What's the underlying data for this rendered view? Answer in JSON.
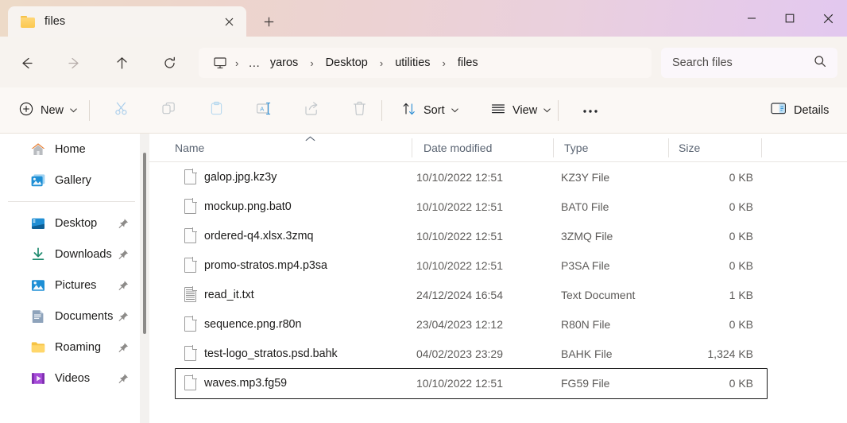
{
  "window": {
    "tab": {
      "title": "files",
      "folder_icon": "folder-icon",
      "close_icon": "close-icon"
    },
    "new_tab_icon": "plus-icon",
    "controls": {
      "minimize": "minimize-icon",
      "maximize": "maximize-icon",
      "close": "close-icon"
    }
  },
  "nav": {
    "back": "arrow-left-icon",
    "forward": "arrow-right-icon",
    "up": "arrow-up-icon",
    "refresh": "refresh-icon"
  },
  "address": {
    "pc_icon": "this-pc-monitor-icon",
    "overflow": "…",
    "crumbs": [
      "yaros",
      "Desktop",
      "utilities",
      "files"
    ],
    "separator": "›"
  },
  "search": {
    "placeholder": "Search files",
    "icon": "search-icon"
  },
  "toolbar": {
    "new_label": "New",
    "new_icon": "plus-circle-icon",
    "cut_icon": "scissors-icon",
    "copy_icon": "copy-icon",
    "paste_icon": "clipboard-paste-icon",
    "rename_icon": "rename-icon",
    "share_icon": "share-icon",
    "delete_icon": "trash-icon",
    "sort_label": "Sort",
    "sort_icon": "sort-arrows-icon",
    "view_label": "View",
    "view_icon": "list-lines-icon",
    "more_label": "•••",
    "details_label": "Details",
    "details_icon": "details-pane-icon",
    "chevron": "˅"
  },
  "sidebar": {
    "items": [
      {
        "label": "Home",
        "icon": "home-icon",
        "pinned": false
      },
      {
        "label": "Gallery",
        "icon": "gallery-photo-icon",
        "pinned": false
      },
      {
        "label": "Desktop",
        "icon": "desktop-icon",
        "pinned": true
      },
      {
        "label": "Downloads",
        "icon": "downloads-arrow-icon",
        "pinned": true
      },
      {
        "label": "Pictures",
        "icon": "pictures-icon",
        "pinned": true
      },
      {
        "label": "Documents",
        "icon": "documents-icon",
        "pinned": true
      },
      {
        "label": "Roaming",
        "icon": "folder-icon",
        "pinned": true
      },
      {
        "label": "Videos",
        "icon": "videos-film-icon",
        "pinned": true
      }
    ],
    "pin_icon": "pin-icon"
  },
  "filelist": {
    "columns": [
      {
        "key": "name",
        "label": "Name",
        "sorted": "asc",
        "sort_icon": "chevron-up-icon"
      },
      {
        "key": "date",
        "label": "Date modified",
        "sorted": null
      },
      {
        "key": "type",
        "label": "Type",
        "sorted": null
      },
      {
        "key": "size",
        "label": "Size",
        "sorted": null
      }
    ],
    "rows": [
      {
        "name": "galop.jpg.kz3y",
        "date": "10/10/2022 12:51",
        "type": "KZ3Y File",
        "size": "0 KB",
        "icon": "generic-file-icon",
        "focused": false
      },
      {
        "name": "mockup.png.bat0",
        "date": "10/10/2022 12:51",
        "type": "BAT0 File",
        "size": "0 KB",
        "icon": "generic-file-icon",
        "focused": false
      },
      {
        "name": "ordered-q4.xlsx.3zmq",
        "date": "10/10/2022 12:51",
        "type": "3ZMQ File",
        "size": "0 KB",
        "icon": "generic-file-icon",
        "focused": false
      },
      {
        "name": "promo-stratos.mp4.p3sa",
        "date": "10/10/2022 12:51",
        "type": "P3SA File",
        "size": "0 KB",
        "icon": "generic-file-icon",
        "focused": false
      },
      {
        "name": "read_it.txt",
        "date": "24/12/2024 16:54",
        "type": "Text Document",
        "size": "1 KB",
        "icon": "text-file-icon",
        "focused": false
      },
      {
        "name": "sequence.png.r80n",
        "date": "23/04/2023 12:12",
        "type": "R80N File",
        "size": "0 KB",
        "icon": "generic-file-icon",
        "focused": false
      },
      {
        "name": "test-logo_stratos.psd.bahk",
        "date": "04/02/2023 23:29",
        "type": "BAHK File",
        "size": "1,324 KB",
        "icon": "generic-file-icon",
        "focused": false
      },
      {
        "name": "waves.mp3.fg59",
        "date": "10/10/2022 12:51",
        "type": "FG59 File",
        "size": "0 KB",
        "icon": "generic-file-icon",
        "focused": true
      }
    ]
  },
  "colors": {
    "titlebar_left": "#eddac8",
    "titlebar_right": "#e2c8ef",
    "chrome_bg": "#f7f3ef",
    "command_bg": "#fbf8f5",
    "accent_blue": "#0f6cbd",
    "folder_yellow": "#fbc84f",
    "focus_outline": "#1a1a1a"
  }
}
